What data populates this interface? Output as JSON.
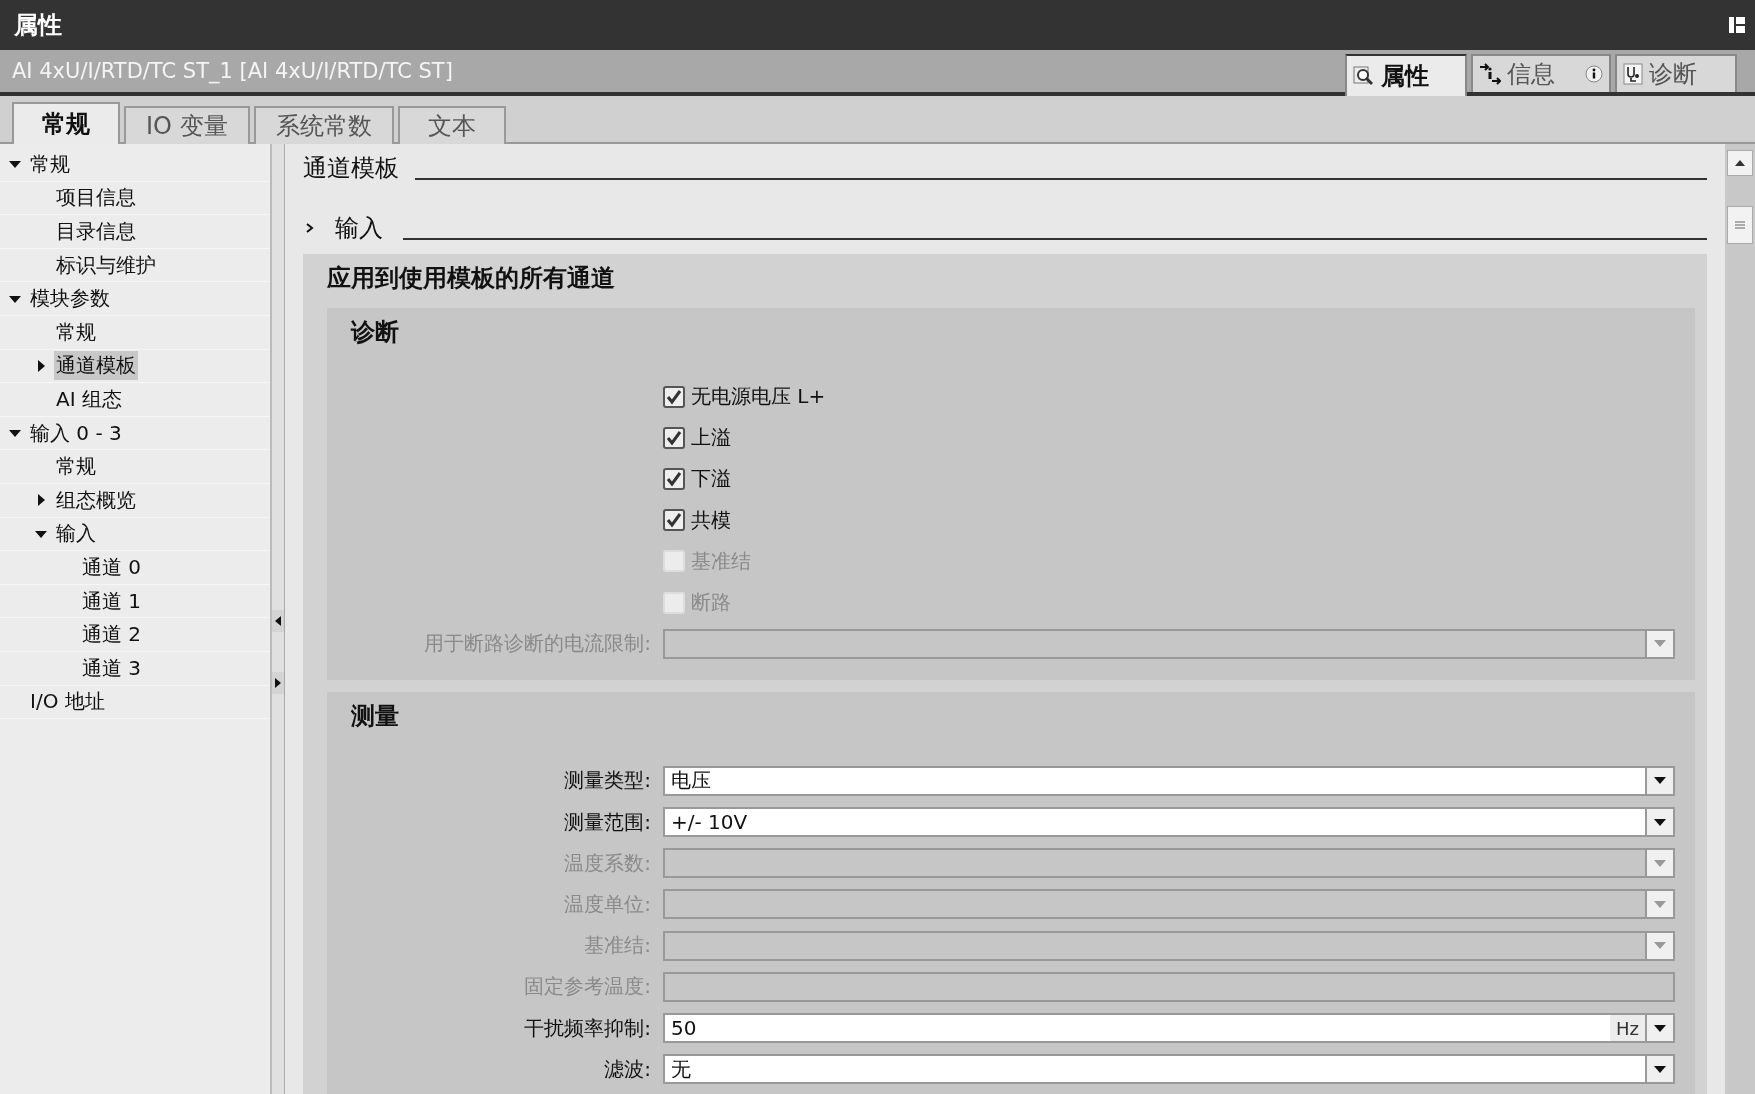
{
  "window": {
    "title": "属性"
  },
  "header": {
    "object_name": "AI 4xU/I/RTD/TC ST_1 [AI 4xU/I/RTD/TC ST]"
  },
  "view_tabs": [
    {
      "label": "属性",
      "kind": "properties",
      "selected": true
    },
    {
      "label": "信息",
      "kind": "info",
      "selected": false
    },
    {
      "label": "诊断",
      "kind": "diagnostics",
      "selected": false
    }
  ],
  "tabs": [
    {
      "label": "常规",
      "selected": true
    },
    {
      "label": "IO 变量",
      "selected": false
    },
    {
      "label": "系统常数",
      "selected": false
    },
    {
      "label": "文本",
      "selected": false
    }
  ],
  "tree": [
    {
      "label": "常规",
      "expanded": true,
      "selected": false,
      "children": [
        {
          "label": "项目信息",
          "selected": false
        },
        {
          "label": "目录信息",
          "selected": false
        },
        {
          "label": "标识与维护",
          "selected": false
        }
      ]
    },
    {
      "label": "模块参数",
      "expanded": true,
      "selected": false,
      "children": [
        {
          "label": "常规",
          "selected": false
        },
        {
          "label": "通道模板",
          "expanded": false,
          "selected": true
        },
        {
          "label": "AI 组态",
          "selected": false
        }
      ]
    },
    {
      "label": "输入 0 - 3",
      "expanded": true,
      "selected": false,
      "children": [
        {
          "label": "常规",
          "selected": false
        },
        {
          "label": "组态概览",
          "expanded": false,
          "selected": false
        },
        {
          "label": "输入",
          "expanded": true,
          "selected": false,
          "children": [
            {
              "label": "通道 0",
              "selected": false
            },
            {
              "label": "通道 1",
              "selected": false
            },
            {
              "label": "通道 2",
              "selected": false
            },
            {
              "label": "通道 3",
              "selected": false
            }
          ]
        }
      ]
    },
    {
      "label": "I/O 地址",
      "selected": false
    }
  ],
  "content": {
    "heading": "通道模板",
    "subheading": "输入",
    "subheading_expanded": false,
    "panel_title": "应用到使用模板的所有通道",
    "diagnostics": {
      "title": "诊断",
      "checkboxes": [
        {
          "label": "无电源电压 L+",
          "checked": true,
          "disabled": false
        },
        {
          "label": "上溢",
          "checked": true,
          "disabled": false
        },
        {
          "label": "下溢",
          "checked": true,
          "disabled": false
        },
        {
          "label": "共模",
          "checked": true,
          "disabled": false
        },
        {
          "label": "基准结",
          "checked": false,
          "disabled": true
        },
        {
          "label": "断路",
          "checked": false,
          "disabled": true
        }
      ],
      "fields": [
        {
          "label": "用于断路诊断的电流限制:",
          "kind": "dropdown",
          "disabled": true
        }
      ]
    },
    "measurement": {
      "title": "测量",
      "fields": [
        {
          "label": "测量类型:",
          "kind": "dropdown",
          "value": "电压",
          "disabled": false
        },
        {
          "label": "测量范围:",
          "kind": "dropdown",
          "value": "+/- 10V",
          "disabled": false
        },
        {
          "label": "温度系数:",
          "kind": "dropdown",
          "disabled": true
        },
        {
          "label": "温度单位:",
          "kind": "dropdown",
          "disabled": true
        },
        {
          "label": "基准结:",
          "kind": "dropdown",
          "disabled": true
        },
        {
          "label": "固定参考温度:",
          "kind": "text",
          "disabled": true
        },
        {
          "label": "干扰频率抑制:",
          "kind": "dropdown",
          "value": "50",
          "unit": "Hz",
          "disabled": false
        },
        {
          "label": "滤波:",
          "kind": "dropdown",
          "value": "无",
          "disabled": false
        }
      ]
    }
  }
}
